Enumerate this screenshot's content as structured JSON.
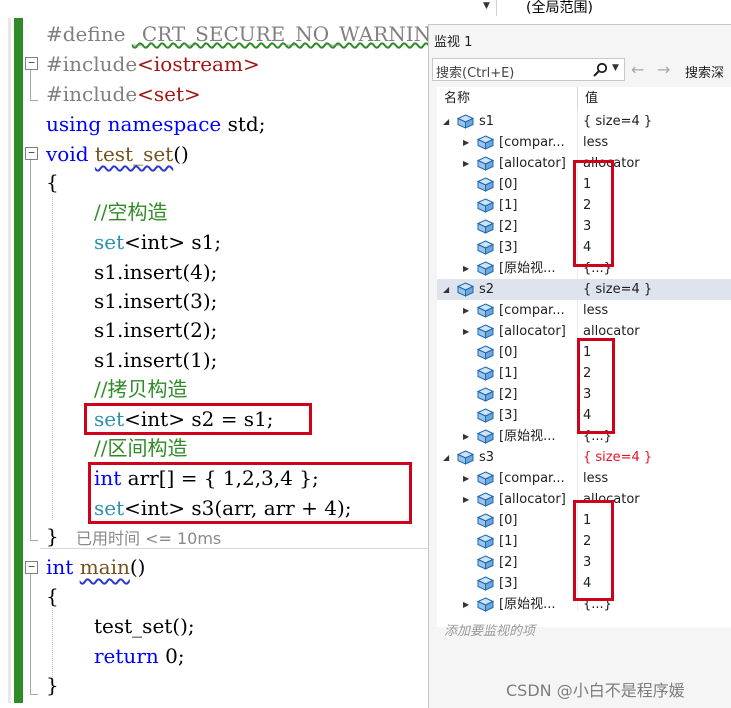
{
  "editor": {
    "lines": {
      "l1_define": "#define",
      "l1_macro": "_CRT_SECURE_NO_WARNINGS",
      "l2_include": "#include",
      "l2_header": "<iostream>",
      "l3_include": "#include",
      "l3_header": "<set>",
      "l4_using": "using",
      "l4_namespace": "namespace",
      "l4_std": "std;",
      "l5_void": "void",
      "l5_fn": "test_set",
      "l5_parens": "()",
      "l6_brace": "{",
      "l7_comment": "//空构造",
      "l8_set": "set",
      "l8_tmpl": "<int>",
      "l8_rest": " s1;",
      "l9": "s1.insert(4);",
      "l10": "s1.insert(3);",
      "l11": "s1.insert(2);",
      "l12": "s1.insert(1);",
      "l13_comment": "//拷贝构造",
      "l14_set": "set",
      "l14_tmpl": "<int>",
      "l14_rest": " s2 = s1;",
      "l15_comment": "//区间构造",
      "l16_int": "int",
      "l16_rest": " arr[] = { 1,2,3,4 };",
      "l17_set": "set",
      "l17_tmpl": "<int>",
      "l17_rest": " s3(arr, arr + 4);",
      "l18_brace": "}",
      "l19_int": "int",
      "l19_fn": "main",
      "l19_parens": "()",
      "l20_brace": "{",
      "l21": "test_set();",
      "l22_return": "return",
      "l22_rest": " 0;",
      "l23_brace": "}"
    },
    "elapsed": "已用时间 <= 10ms"
  },
  "top_combo": {
    "scope": "(全局范围)"
  },
  "watch": {
    "title": "监视 1",
    "search_placeholder": "搜索(Ctrl+E)",
    "search_depth_label": "搜索深",
    "col_name": "名称",
    "col_value": "值",
    "add_watch_hint": "添加要监视的项",
    "rows": [
      {
        "name": "s1",
        "value": "{ size=4 }",
        "level": 0,
        "expander": "open"
      },
      {
        "name": "[compar...",
        "value": "less",
        "level": 1,
        "expander": "closed"
      },
      {
        "name": "[allocator]",
        "value": "allocator",
        "level": 1,
        "expander": "closed"
      },
      {
        "name": "[0]",
        "value": "1",
        "level": 1,
        "expander": "none"
      },
      {
        "name": "[1]",
        "value": "2",
        "level": 1,
        "expander": "none"
      },
      {
        "name": "[2]",
        "value": "3",
        "level": 1,
        "expander": "none"
      },
      {
        "name": "[3]",
        "value": "4",
        "level": 1,
        "expander": "none"
      },
      {
        "name": "[原始视...",
        "value": "{...}",
        "level": 1,
        "expander": "closed"
      },
      {
        "name": "s2",
        "value": "{ size=4 }",
        "level": 0,
        "expander": "open",
        "selected": true
      },
      {
        "name": "[compar...",
        "value": "less",
        "level": 1,
        "expander": "closed"
      },
      {
        "name": "[allocator]",
        "value": "allocator",
        "level": 1,
        "expander": "closed"
      },
      {
        "name": "[0]",
        "value": "1",
        "level": 1,
        "expander": "none"
      },
      {
        "name": "[1]",
        "value": "2",
        "level": 1,
        "expander": "none"
      },
      {
        "name": "[2]",
        "value": "3",
        "level": 1,
        "expander": "none"
      },
      {
        "name": "[3]",
        "value": "4",
        "level": 1,
        "expander": "none"
      },
      {
        "name": "[原始视...",
        "value": "{...}",
        "level": 1,
        "expander": "closed"
      },
      {
        "name": "s3",
        "value": "{ size=4 }",
        "level": 0,
        "expander": "open",
        "changed": true
      },
      {
        "name": "[compar...",
        "value": "less",
        "level": 1,
        "expander": "closed"
      },
      {
        "name": "[allocator]",
        "value": "allocator",
        "level": 1,
        "expander": "closed"
      },
      {
        "name": "[0]",
        "value": "1",
        "level": 1,
        "expander": "none"
      },
      {
        "name": "[1]",
        "value": "2",
        "level": 1,
        "expander": "none"
      },
      {
        "name": "[2]",
        "value": "3",
        "level": 1,
        "expander": "none"
      },
      {
        "name": "[3]",
        "value": "4",
        "level": 1,
        "expander": "none"
      },
      {
        "name": "[原始视...",
        "value": "{...}",
        "level": 1,
        "expander": "closed"
      }
    ]
  },
  "watermark": "CSDN @小白不是程序媛",
  "colors": {
    "keyword": "#0000ff",
    "comment": "#2e8b26",
    "type": "#2b91af",
    "highlight_box": "#d0021b",
    "changed_value": "#e81123"
  }
}
